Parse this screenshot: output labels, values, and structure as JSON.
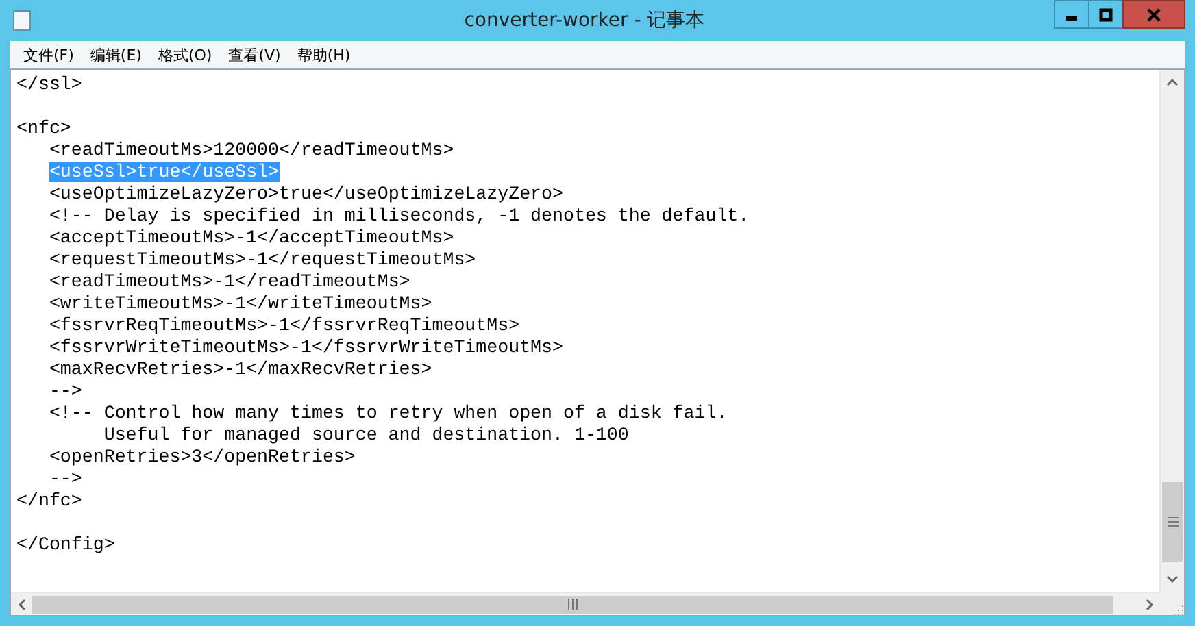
{
  "window": {
    "title": "converter-worker - 记事本"
  },
  "menu": [
    "文件(F)",
    "编辑(E)",
    "格式(O)",
    "查看(V)",
    "帮助(H)"
  ],
  "editor": {
    "lines": [
      {
        "text": "</ssl>",
        "selected": false
      },
      {
        "selected": false
      },
      {
        "text": "<nfc>",
        "selected": false
      },
      {
        "text": "   <readTimeoutMs>120000</readTimeoutMs>",
        "selected": false
      },
      {
        "text": "   <useSsl>true</useSsl>",
        "selected": true
      },
      {
        "text": "   <useOptimizeLazyZero>true</useOptimizeLazyZero>",
        "selected": false
      },
      {
        "text": "   <!-- Delay is specified in milliseconds, -1 denotes the default.",
        "selected": false
      },
      {
        "text": "   <acceptTimeoutMs>-1</acceptTimeoutMs>",
        "selected": false
      },
      {
        "text": "   <requestTimeoutMs>-1</requestTimeoutMs>",
        "selected": false
      },
      {
        "text": "   <readTimeoutMs>-1</readTimeoutMs>",
        "selected": false
      },
      {
        "text": "   <writeTimeoutMs>-1</writeTimeoutMs>",
        "selected": false
      },
      {
        "text": "   <fssrvrReqTimeoutMs>-1</fssrvrReqTimeoutMs>",
        "selected": false
      },
      {
        "text": "   <fssrvrWriteTimeoutMs>-1</fssrvrWriteTimeoutMs>",
        "selected": false
      },
      {
        "text": "   <maxRecvRetries>-1</maxRecvRetries>",
        "selected": false
      },
      {
        "text": "   -->",
        "selected": false
      },
      {
        "text": "   <!-- Control how many times to retry when open of a disk fail.",
        "selected": false
      },
      {
        "text": "        Useful for managed source and destination. 1-100",
        "selected": false
      },
      {
        "text": "   <openRetries>3</openRetries>",
        "selected": false
      },
      {
        "text": "   -->",
        "selected": false
      },
      {
        "text": "</nfc>",
        "selected": false
      },
      {
        "selected": false
      },
      {
        "text": "</Config>",
        "selected": false
      }
    ]
  }
}
